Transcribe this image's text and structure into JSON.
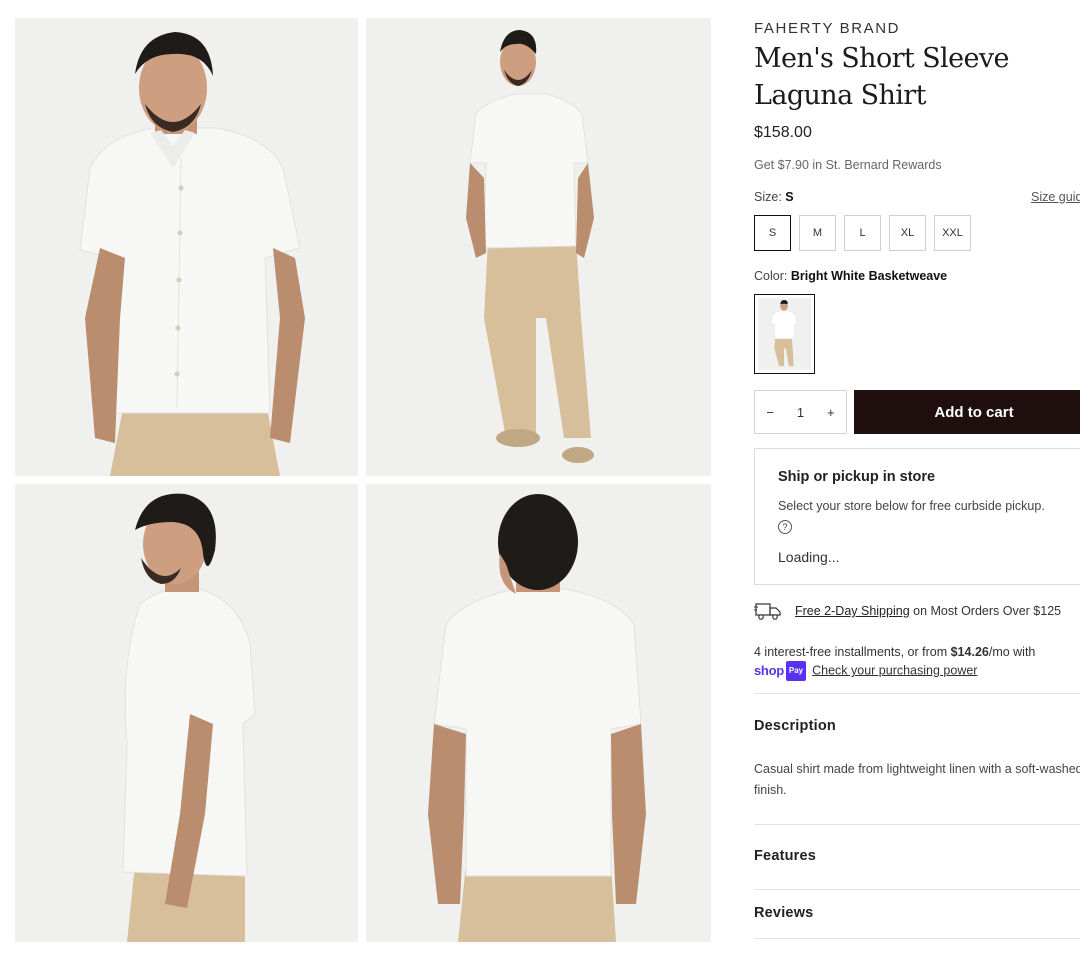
{
  "gallery": {
    "images": [
      {
        "alt": "front close-up"
      },
      {
        "alt": "full body front"
      },
      {
        "alt": "side profile"
      },
      {
        "alt": "back view"
      }
    ]
  },
  "product": {
    "brand": "FAHERTY BRAND",
    "title": "Men's Short Sleeve Laguna Shirt",
    "price": "$158.00",
    "rewards": "Get $7.90 in St. Bernard Rewards"
  },
  "size": {
    "label": "Size: ",
    "selected": "S",
    "guide": "Size guide",
    "options": [
      "S",
      "M",
      "L",
      "XL",
      "XXL"
    ]
  },
  "color": {
    "label": "Color: ",
    "selected": "Bright White Basketweave"
  },
  "cart": {
    "minus": "−",
    "quantity": "1",
    "plus": "+",
    "add_label": "Add to cart",
    "button_color": "#1f0f0f"
  },
  "store": {
    "heading": "Ship or pickup in store",
    "description": "Select your store below for free curbside pickup.",
    "help": "?",
    "status": "Loading..."
  },
  "shipping": {
    "link": "Free 2-Day Shipping",
    "rest": " on Most Orders Over $125"
  },
  "installments": {
    "text_a": "4 interest-free installments, or from ",
    "amount": "$14.26",
    "text_b": "/mo with",
    "shop": "shop",
    "pay": "Pay",
    "link": "Check your purchasing power",
    "brand_color": "#5a31f4"
  },
  "sections": {
    "description_title": "Description",
    "description_text": "Casual shirt made from lightweight linen with a soft-washed finish.",
    "features_title": "Features",
    "reviews_title": "Reviews"
  }
}
